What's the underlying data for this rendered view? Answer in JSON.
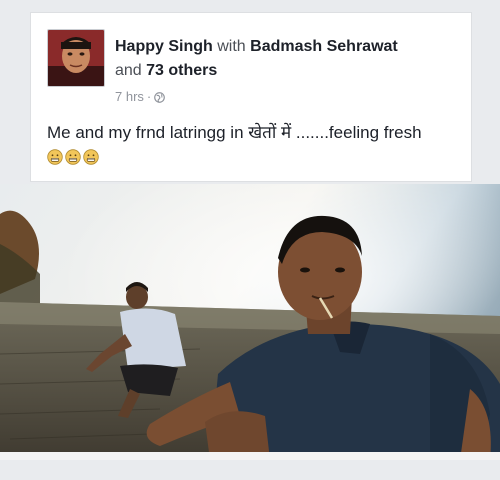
{
  "post": {
    "author": "Happy Singh",
    "with_word": "with",
    "tagged": "Badmash Sehrawat",
    "and_word": "and",
    "others": "73 others",
    "time": "7 hrs",
    "separator": "·",
    "privacy_icon": "globe-icon",
    "status_text": "Me and my frnd latringg in खेतों में .......feeling fresh",
    "status_emojis": [
      "grimace-emoji",
      "grimace-emoji",
      "grimace-emoji"
    ]
  },
  "colors": {
    "page_bg": "#e9ebee",
    "card_bg": "#ffffff",
    "text_main": "#1d2129",
    "text_meta": "#90949c"
  }
}
